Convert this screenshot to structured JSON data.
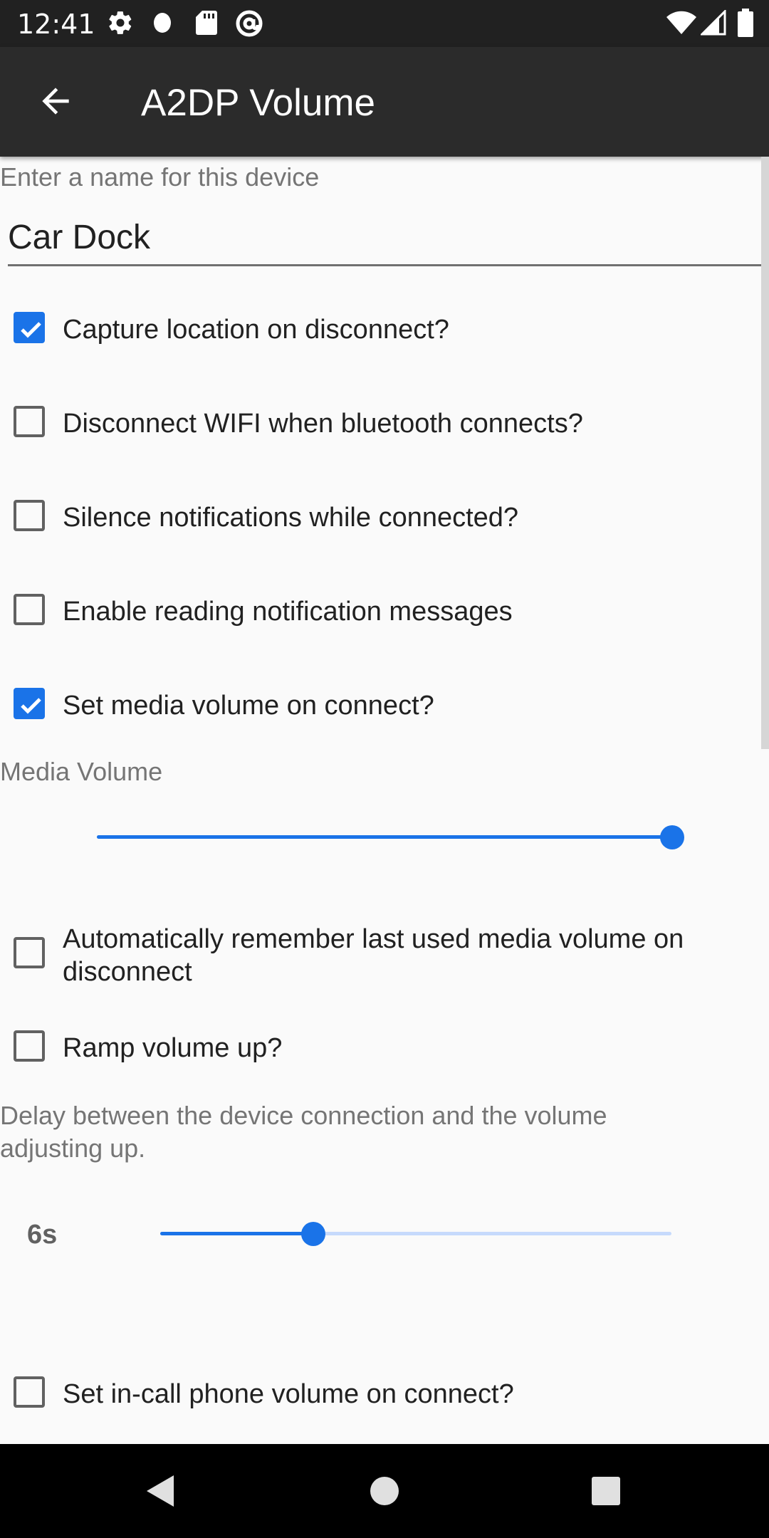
{
  "status_bar": {
    "time": "12:41",
    "icons": [
      "settings-gear-icon",
      "circle-icon",
      "sd-card-icon",
      "at-sign-icon",
      "wifi-icon",
      "cell-signal-icon",
      "battery-icon"
    ]
  },
  "app_bar": {
    "title": "A2DP Volume",
    "back_icon": "arrow-back-icon"
  },
  "device_name": {
    "label": "Enter a name for this device",
    "value": "Car Dock"
  },
  "options": [
    {
      "label": "Capture location on disconnect?",
      "checked": true
    },
    {
      "label": "Disconnect WIFI when bluetooth connects?",
      "checked": false
    },
    {
      "label": "Silence notifications while connected?",
      "checked": false
    },
    {
      "label": "Enable reading notification messages",
      "checked": false
    },
    {
      "label": "Set media volume on connect?",
      "checked": true
    }
  ],
  "media_volume": {
    "label": "Media Volume",
    "level": 1.0
  },
  "options2": [
    {
      "label": "Automatically remember last used media volume on disconnect",
      "checked": false
    },
    {
      "label": "Ramp volume up?",
      "checked": false
    }
  ],
  "ramp_delay": {
    "label": "Delay between the device connection and the volume adjusting up.",
    "value_text": "6s",
    "level": 0.3
  },
  "options3": [
    {
      "label": "Set in-call phone volume on connect?",
      "checked": false
    }
  ],
  "colors": {
    "accent": "#1a73e8",
    "app_bar": "#2b2b2b",
    "status_bar": "#212121",
    "background": "#fafafa"
  },
  "nav_bar": {
    "icons": [
      "back-triangle-icon",
      "home-circle-icon",
      "recents-square-icon"
    ]
  }
}
